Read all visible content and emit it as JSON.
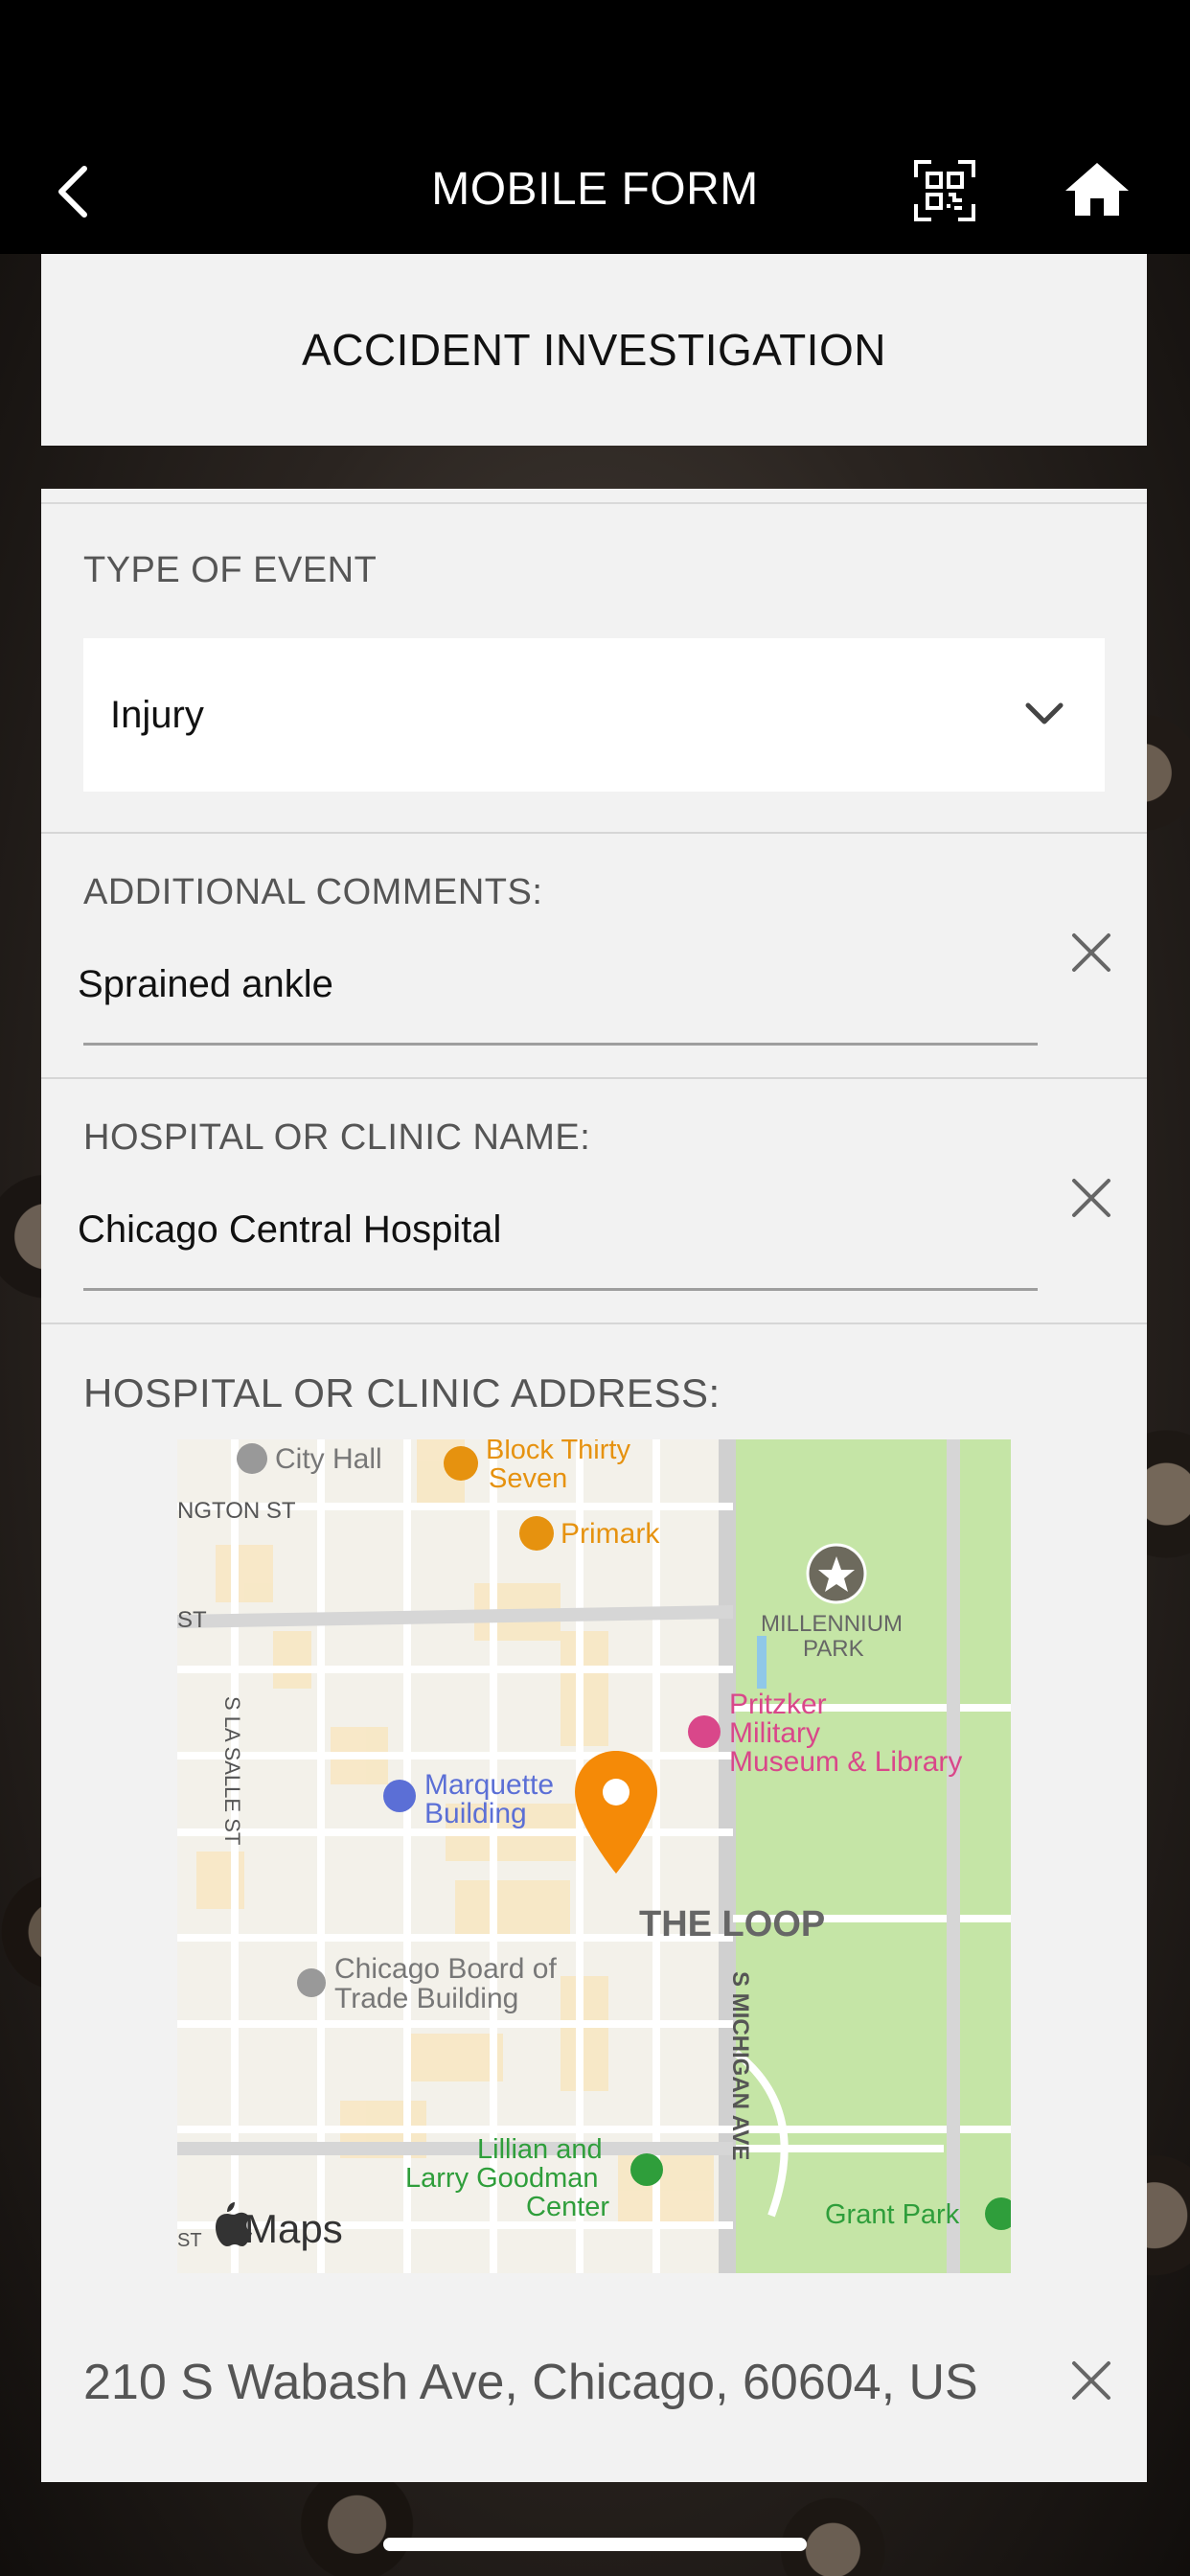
{
  "nav": {
    "title": "MOBILE FORM",
    "back_icon": "chevron-left-icon",
    "scan_icon": "qr-scan-icon",
    "home_icon": "home-icon"
  },
  "form": {
    "title": "ACCIDENT INVESTIGATION"
  },
  "fields": {
    "event_type": {
      "label": "TYPE OF EVENT",
      "value": "Injury"
    },
    "comments": {
      "label": "ADDITIONAL COMMENTS:",
      "value": "Sprained ankle"
    },
    "hospital_name": {
      "label": "HOSPITAL OR CLINIC NAME:",
      "value": "Chicago Central Hospital"
    },
    "hospital_address": {
      "label": "HOSPITAL OR CLINIC ADDRESS:",
      "value": "210 S Wabash Ave, Chicago, 60604, US"
    }
  },
  "map": {
    "labels": {
      "city_hall": "City Hall",
      "block37_a": "Block Thirty",
      "block37_b": "Seven",
      "washington": "NGTON ST",
      "primark": "Primark",
      "millennium_a": "MILLENNIUM",
      "millennium_b": "PARK",
      "st_left": "ST",
      "lasalle": "S LA SALLE ST",
      "pritzker_a": "Pritzker",
      "pritzker_b": "Military",
      "pritzker_c": "Museum & Library",
      "marquette_a": "Marquette",
      "marquette_b": "Building",
      "loop": "THE LOOP",
      "cbot_a": "Chicago Board of",
      "cbot_b": "Trade Building",
      "michigan": "S MICHIGAN AVE",
      "lillian_a": "Lillian and",
      "lillian_b": "Larry Goodman",
      "lillian_c": "Center",
      "grant_park": "Grant Park",
      "maps_logo": "Maps",
      "st_bottom": "ST"
    },
    "colors": {
      "park": "#c5e5a6",
      "pin": "#f58a07",
      "poi_orange": "#e6920f",
      "poi_pink": "#d9478a",
      "poi_blue": "#5b6fd6",
      "poi_green": "#2f9e3b"
    }
  }
}
